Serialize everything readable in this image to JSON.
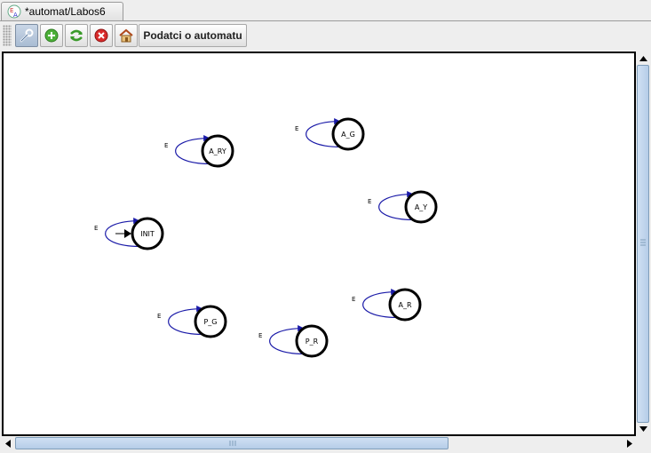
{
  "window": {
    "tab_title": "*automat/Labos6"
  },
  "toolbar": {
    "buttons": [
      {
        "name": "edit-tool",
        "icon": "wrench-icon",
        "active": true
      },
      {
        "name": "add-state",
        "icon": "plus-circle-icon",
        "active": false
      },
      {
        "name": "refresh",
        "icon": "refresh-arrows-icon",
        "active": false
      },
      {
        "name": "delete",
        "icon": "delete-x-icon",
        "active": false
      },
      {
        "name": "home",
        "icon": "home-icon",
        "active": false
      }
    ],
    "info_button_label": "Podatci o automatu"
  },
  "automaton": {
    "initial_state": "INIT",
    "states": [
      {
        "id": "init",
        "label": "INIT",
        "loop_label": "E",
        "initial": true
      },
      {
        "id": "a_ry",
        "label": "A_RY",
        "loop_label": "E"
      },
      {
        "id": "a_g",
        "label": "A_G",
        "loop_label": "E"
      },
      {
        "id": "a_y",
        "label": "A_Y",
        "loop_label": "E"
      },
      {
        "id": "a_r",
        "label": "A_R",
        "loop_label": "E"
      },
      {
        "id": "p_g",
        "label": "P_G",
        "loop_label": "E"
      },
      {
        "id": "p_r",
        "label": "P_R",
        "loop_label": "E"
      }
    ]
  },
  "colors": {
    "loop_edge": "#1a1aa8",
    "state_border": "#000000",
    "scroll_thumb": "#b6cde8"
  }
}
